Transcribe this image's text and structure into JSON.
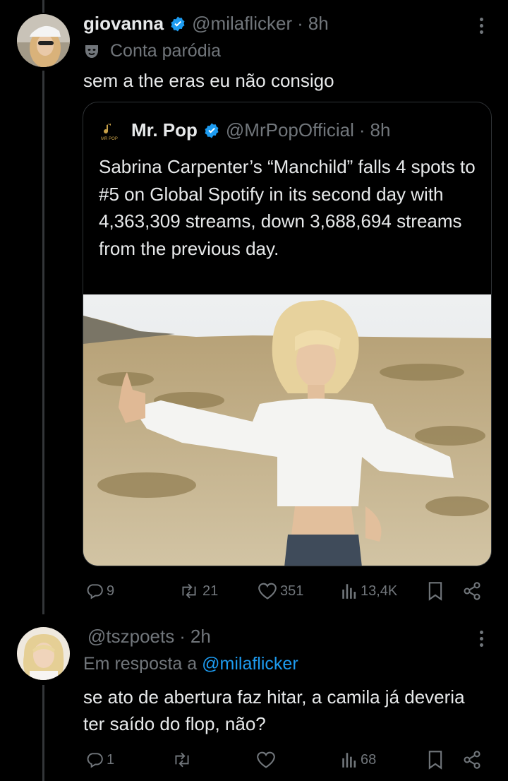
{
  "post": {
    "display_name": "giovanna",
    "handle": "@milaflicker",
    "separator": "·",
    "time": "8h",
    "parody_label": "Conta paródia",
    "text": "sem a the eras eu não consigo",
    "quote": {
      "display_name": "Mr. Pop",
      "handle": "@MrPopOfficial",
      "separator": "·",
      "time": "8h",
      "logo_text": "MR POP",
      "text": "Sabrina Carpenter’s “Manchild” falls 4 spots to #5 on Global Spotify in its second day with 4,363,309 streams, down 3,688,694 streams from the previous day."
    },
    "actions": {
      "replies": "9",
      "reposts": "21",
      "likes": "351",
      "views": "13,4K"
    }
  },
  "reply": {
    "display_name": "",
    "handle": "@tszpoets",
    "separator": "·",
    "time": "2h",
    "reply_prefix": "Em resposta a",
    "reply_to": "@milaflicker",
    "text": "se ato de abertura faz hitar, a camila já deveria ter saído do flop, não?",
    "actions": {
      "replies": "1",
      "reposts": "",
      "likes": "",
      "views": "68"
    }
  },
  "colors": {
    "background": "#000000",
    "text": "#e7e9ea",
    "muted": "#71767b",
    "accent": "#1d9bf0",
    "border": "#2f3336"
  },
  "icons": [
    "verified-badge-icon",
    "parody-mask-icon",
    "more-icon",
    "reply-icon",
    "repost-icon",
    "like-icon",
    "views-icon",
    "bookmark-icon",
    "share-icon"
  ]
}
